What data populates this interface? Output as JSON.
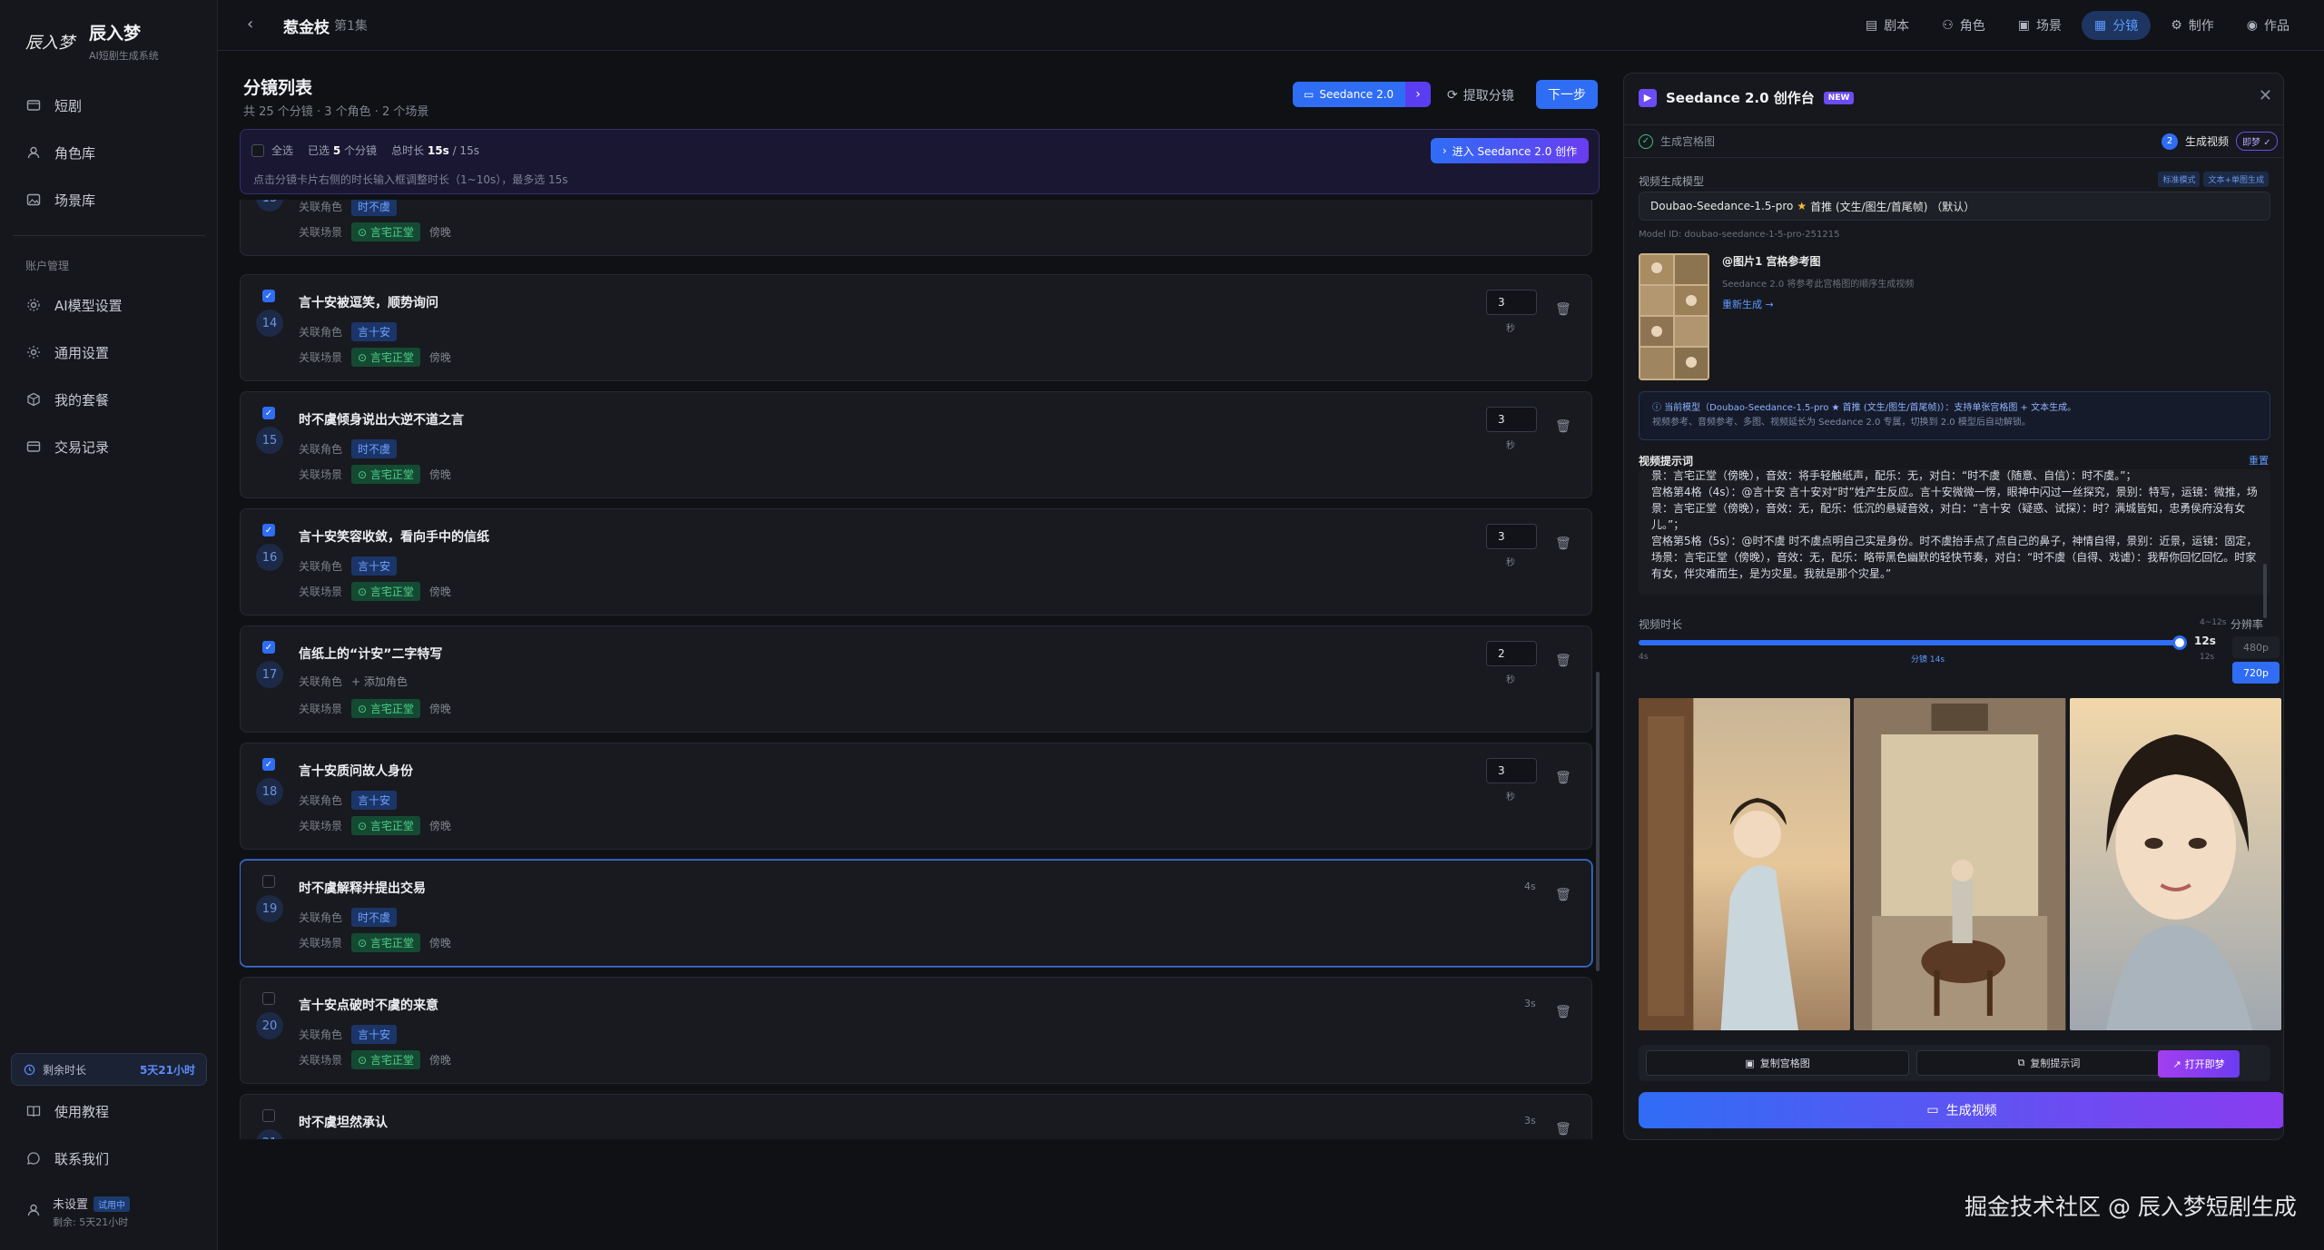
{
  "brand": {
    "logo": "辰入梦",
    "name": "辰入梦",
    "subtitle": "AI短剧生成系统"
  },
  "sidebar": {
    "main": [
      {
        "label": "短剧",
        "icon": "film-icon"
      },
      {
        "label": "角色库",
        "icon": "user-icon"
      },
      {
        "label": "场景库",
        "icon": "image-icon"
      }
    ],
    "section_label": "账户管理",
    "account": [
      {
        "label": "AI模型设置",
        "icon": "gear-icon"
      },
      {
        "label": "通用设置",
        "icon": "settings-icon"
      },
      {
        "label": "我的套餐",
        "icon": "package-icon"
      },
      {
        "label": "交易记录",
        "icon": "receipt-icon"
      }
    ],
    "quota_label": "剩余时长",
    "quota_value": "5天21小时",
    "bottom": [
      {
        "label": "使用教程",
        "icon": "book-icon"
      },
      {
        "label": "联系我们",
        "icon": "chat-icon"
      }
    ],
    "user": {
      "name": "未设置",
      "badge": "试用中",
      "remain": "剩余: 5天21小时"
    }
  },
  "topbar": {
    "title": "惹金枝",
    "episode": "第1集",
    "nav": [
      {
        "label": "剧本",
        "icon": "doc-icon",
        "active": false
      },
      {
        "label": "角色",
        "icon": "user-icon",
        "active": false
      },
      {
        "label": "场景",
        "icon": "image-icon",
        "active": false
      },
      {
        "label": "分镜",
        "icon": "storyboard-icon",
        "active": true
      },
      {
        "label": "制作",
        "icon": "gear-icon",
        "active": false
      },
      {
        "label": "作品",
        "icon": "play-icon",
        "active": false
      }
    ]
  },
  "list": {
    "title": "分镜列表",
    "subtitle": "共 25 个分镜 · 3 个角色 · 2 个场景",
    "model_pill": "Seedance 2.0",
    "extract_label": "提取分镜",
    "next_label": "下一步",
    "select_all": "全选",
    "selected_prefix": "已选",
    "selected_count": "5",
    "selected_suffix": "个分镜",
    "total_prefix": "总时长",
    "total_value": "15s",
    "total_max": "/ 15s",
    "hint": "点击分镜卡片右侧的时长输入框调整时长（1~10s），最多选 15s",
    "enter_btn": "进入 Seedance 2.0 创作",
    "role_label": "关联角色",
    "scene_label": "关联场景",
    "scene_sub": "傍晚",
    "add_role": "+ 添加角色",
    "dur_unit": "秒"
  },
  "shots": [
    {
      "num": "13",
      "title": "",
      "role": "时不虞",
      "scene": "言宅正堂",
      "checked": false,
      "dur": "",
      "dur_text": ""
    },
    {
      "num": "14",
      "title": "言十安被逗笑，顺势询问",
      "role": "言十安",
      "scene": "言宅正堂",
      "checked": true,
      "dur": "3",
      "dur_text": ""
    },
    {
      "num": "15",
      "title": "时不虞倾身说出大逆不道之言",
      "role": "时不虞",
      "scene": "言宅正堂",
      "checked": true,
      "dur": "3",
      "dur_text": ""
    },
    {
      "num": "16",
      "title": "言十安笑容收敛，看向手中的信纸",
      "role": "言十安",
      "scene": "言宅正堂",
      "checked": true,
      "dur": "3",
      "dur_text": ""
    },
    {
      "num": "17",
      "title": "信纸上的“计安”二字特写",
      "role": "",
      "scene": "言宅正堂",
      "checked": true,
      "dur": "2",
      "dur_text": ""
    },
    {
      "num": "18",
      "title": "言十安质问故人身份",
      "role": "言十安",
      "scene": "言宅正堂",
      "checked": true,
      "dur": "3",
      "dur_text": ""
    },
    {
      "num": "19",
      "title": "时不虞解释并提出交易",
      "role": "时不虞",
      "scene": "言宅正堂",
      "checked": false,
      "dur": "",
      "dur_text": "4s"
    },
    {
      "num": "20",
      "title": "言十安点破时不虞的来意",
      "role": "言十安",
      "scene": "言宅正堂",
      "checked": false,
      "dur": "",
      "dur_text": "3s"
    },
    {
      "num": "21",
      "title": "时不虞坦然承认",
      "role": "",
      "scene": "",
      "checked": false,
      "dur": "",
      "dur_text": "3s"
    }
  ],
  "studio": {
    "title": "Seedance 2.0 创作台",
    "new_badge": "NEW",
    "step1": "生成宫格图",
    "step2_num": "2",
    "step2": "生成视频",
    "jimeng_badge": "即梦 ✓",
    "model_label": "视频生成模型",
    "mode_badges": [
      "标准模式",
      "文本+单图生成"
    ],
    "model_name": "Doubao-Seedance-1.5-pro",
    "model_star": "★",
    "model_extra": "首推 (文生/图生/首尾帧) （默认）",
    "model_id": "Model ID: doubao-seedance-1-5-pro-251215",
    "ref_title": "@图片1 宫格参考图",
    "ref_desc": "Seedance 2.0 将参考此宫格图的顺序生成视频",
    "ref_link": "重新生成 →",
    "note_line1": "当前模型（Doubao-Seedance-1.5-pro ★ 首推 (文生/图生/首尾帧)）：支持单张宫格图 + 文本生成。",
    "note_line2": "视频参考、音频参考、多图、视频延长为 Seedance 2.0 专属，切换到 2.0 模型后自动解锁。",
    "prompt_label": "视频提示词",
    "reset_label": "重置",
    "prompt_lines": [
      "景：言宅正堂（傍晚），音效：将手轻触纸声，配乐：无，对白：“时不虞（随意、自信）：时不虞。”；",
      "宫格第4格（4s）：@言十安 言十安对“时”姓产生反应。言十安微微一愣，眼神中闪过一丝探究，景别：特写，运镜：微推，场景：言宅正堂（傍晚），音效：无，配乐：低沉的悬疑音效，对白：“言十安（疑惑、试探）：时？满城皆知，忠勇侯府没有女儿。”；",
      "宫格第5格（5s）：@时不虞 时不虞点明自己实是身份。时不虞抬手点了点自己的鼻子，神情自得，景别：近景，运镜：固定，场景：言宅正堂（傍晚），音效：无，配乐：略带黑色幽默的轻快节奏，对白：“时不虞（自得、戏谑）：我帮你回忆回忆。时家有女，伴灾难而生，是为灾星。我就是那个灾星。”"
    ],
    "duration_label": "视频时长",
    "duration_range": "4~12s",
    "resolution_label": "分辨率",
    "slider": {
      "min": 4,
      "max": 12,
      "value": 12,
      "min_label": "4s",
      "max_label": "12s",
      "value_label": "12s",
      "mid_label": "分镜 14s"
    },
    "res_options": [
      "480p",
      "720p"
    ],
    "res_selected": "720p",
    "copy_grid": "复制宫格图",
    "copy_prompt": "复制提示词",
    "open_jimeng": "打开即梦",
    "generate": "生成视频"
  },
  "watermark": "掘金技术社区 @ 辰入梦短剧生成"
}
